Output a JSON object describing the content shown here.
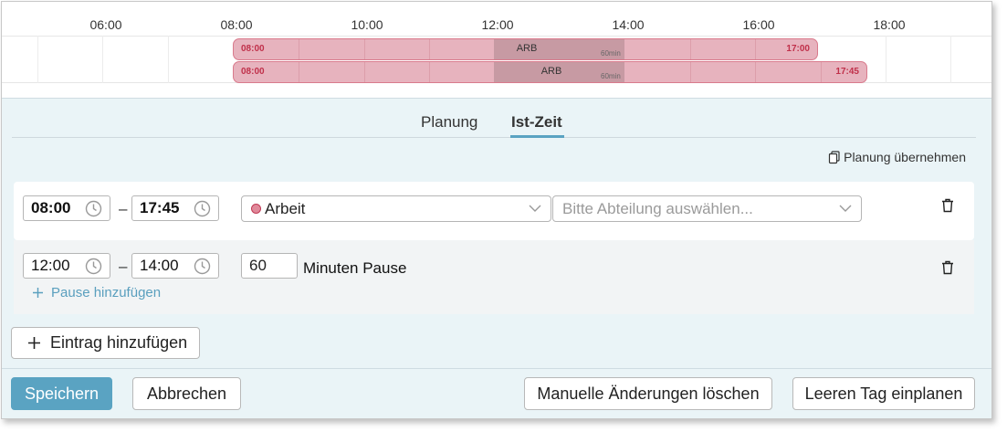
{
  "timeline": {
    "ticks": [
      "06:00",
      "08:00",
      "10:00",
      "12:00",
      "14:00",
      "16:00",
      "18:00"
    ],
    "bars": [
      {
        "start": "08:00",
        "end": "17:00",
        "code": "ARB",
        "pause_label": "60min"
      },
      {
        "start": "08:00",
        "end": "17:45",
        "code": "ARB",
        "pause_label": "60min"
      }
    ],
    "bar_color": "#e7b3be",
    "bar_border_color": "#d97a8c"
  },
  "tabs": [
    {
      "label": "Planung",
      "active": false
    },
    {
      "label": "Ist-Zeit",
      "active": true
    }
  ],
  "adopt_plan_label": "Planung übernehmen",
  "entry": {
    "start": "08:00",
    "end": "17:45",
    "separator": "–",
    "activity": "Arbeit",
    "activity_color": "#e0899a",
    "department_placeholder": "Bitte Abteilung auswählen..."
  },
  "pause": {
    "start": "12:00",
    "end": "14:00",
    "separator": "–",
    "minutes": "60",
    "minutes_label": "Minuten Pause",
    "add_pause_label": "Pause hinzufügen"
  },
  "add_entry_label": "Eintrag hinzufügen",
  "footer": {
    "save_label": "Speichern",
    "cancel_label": "Abbrechen",
    "clear_manual_label": "Manuelle Änderungen löschen",
    "plan_empty_day_label": "Leeren Tag einplanen"
  },
  "accent_color": "#5aa3c2"
}
